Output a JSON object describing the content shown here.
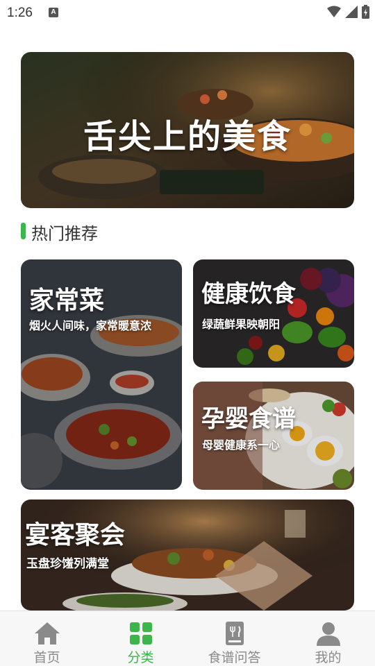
{
  "status_bar": {
    "time": "1:26",
    "notification_letter": "A"
  },
  "banner": {
    "title": "舌尖上的美食"
  },
  "section": {
    "title": "热门推荐"
  },
  "cards": {
    "home_cooking": {
      "title": "家常菜",
      "subtitle": "烟火人间味，家常暖意浓"
    },
    "healthy": {
      "title": "健康饮食",
      "subtitle": "绿蔬鲜果映朝阳"
    },
    "maternal": {
      "title": "孕婴食谱",
      "subtitle": "母婴健康系一心"
    },
    "banquet": {
      "title": "宴客聚会",
      "subtitle": "玉盘珍馐列满堂"
    }
  },
  "nav": {
    "items": [
      {
        "label": "首页",
        "icon": "home-icon"
      },
      {
        "label": "分类",
        "icon": "grid-icon",
        "active": true
      },
      {
        "label": "食谱问答",
        "icon": "recipe-book-icon"
      },
      {
        "label": "我的",
        "icon": "person-icon"
      }
    ]
  },
  "colors": {
    "accent": "#3cb54a",
    "nav_inactive": "#8a8a8a"
  }
}
